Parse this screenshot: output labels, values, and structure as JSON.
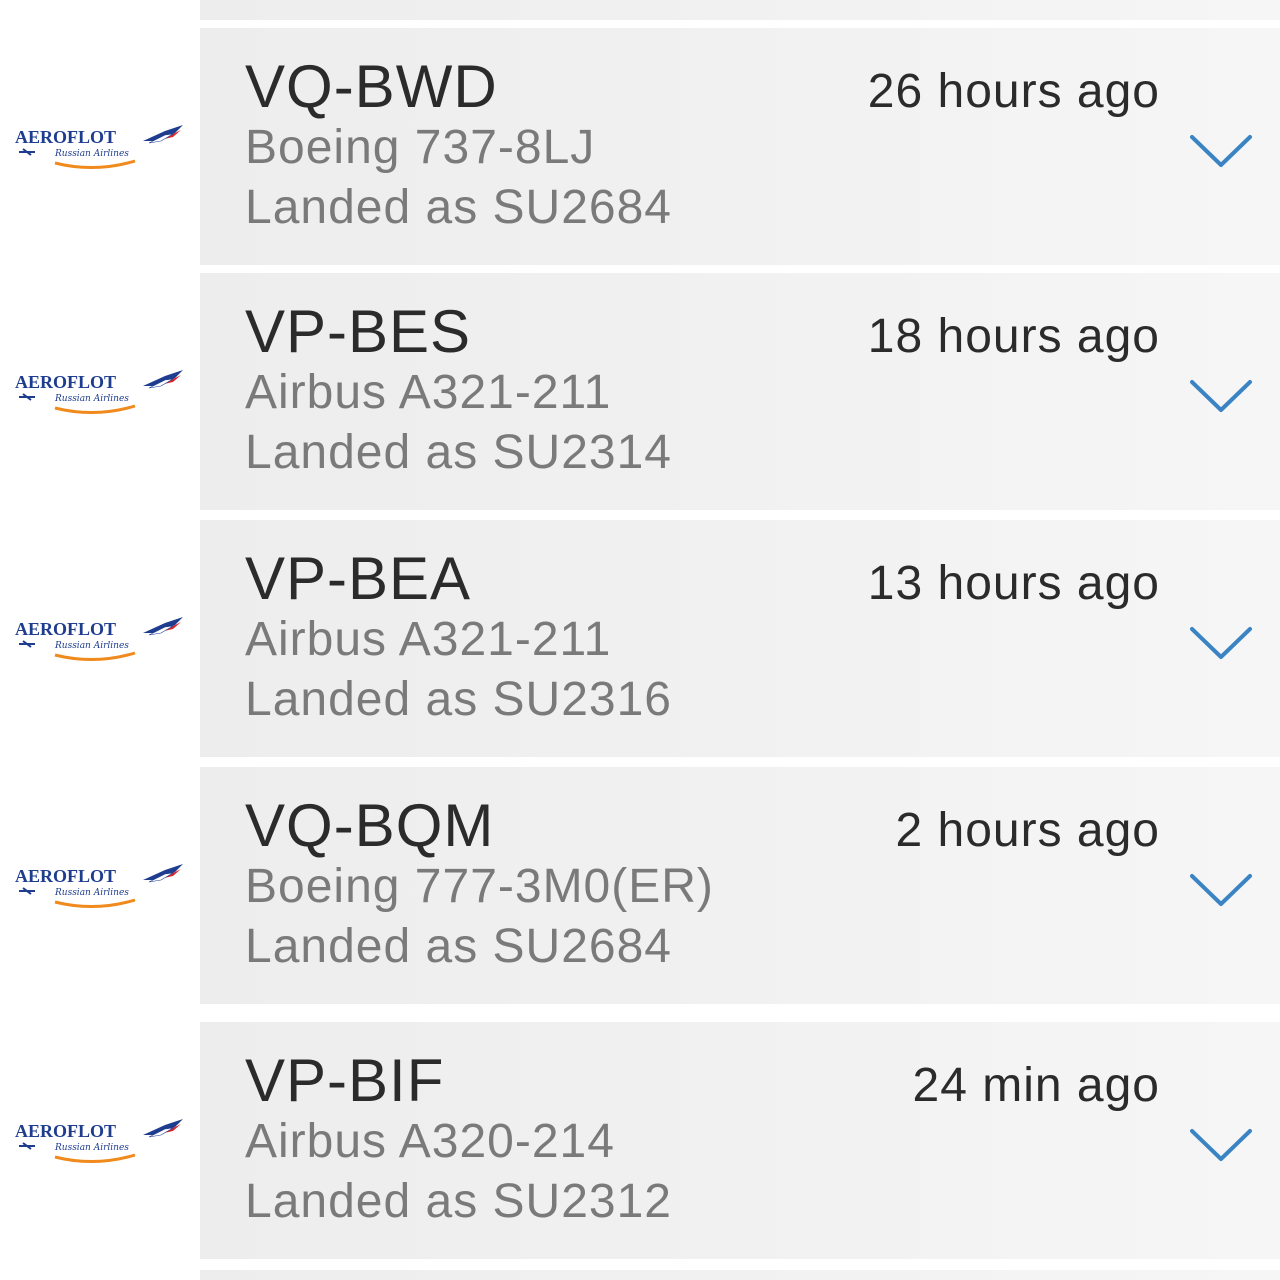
{
  "colors": {
    "accent": "#3b84c4",
    "card_bg": "#efefef",
    "primary_text": "#2b2b2b",
    "secondary_text": "#7a7a7a",
    "logo_blue": "#1e3d8f",
    "logo_orange": "#f08a1c"
  },
  "logo": {
    "brand": "AEROFLOT",
    "tagline": "Russian Airlines"
  },
  "flights": [
    {
      "registration": "VQ-BWD",
      "aircraft": "Boeing 737-8LJ",
      "status": "Landed as SU2684",
      "time": "26 hours ago",
      "expand_icon": "chevron-down-icon"
    },
    {
      "registration": "VP-BES",
      "aircraft": "Airbus A321-211",
      "status": "Landed as SU2314",
      "time": "18 hours ago",
      "expand_icon": "chevron-down-icon"
    },
    {
      "registration": "VP-BEA",
      "aircraft": "Airbus A321-211",
      "status": "Landed as SU2316",
      "time": "13 hours ago",
      "expand_icon": "chevron-down-icon"
    },
    {
      "registration": "VQ-BQM",
      "aircraft": "Boeing 777-3M0(ER)",
      "status": "Landed as SU2684",
      "time": "2 hours ago",
      "expand_icon": "chevron-down-icon"
    },
    {
      "registration": "VP-BIF",
      "aircraft": "Airbus A320-214",
      "status": "Landed as SU2312",
      "time": "24 min ago",
      "expand_icon": "chevron-down-icon"
    }
  ]
}
